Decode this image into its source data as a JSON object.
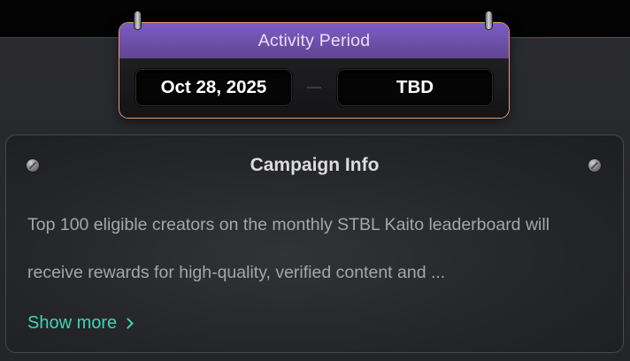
{
  "period": {
    "title": "Activity Period",
    "start_date": "Oct 28, 2025",
    "end_date": "TBD",
    "border_color": "#e89a7b",
    "header_color": "#6f52ad"
  },
  "campaign": {
    "title": "Campaign Info",
    "description": "Top 100 eligible creators on the monthly STBL Kaito leaderboard will receive rewards for high-quality, verified content and ...",
    "show_more_label": "Show more",
    "accent_color": "#3fd5b5"
  },
  "icons": {
    "hangers": "hook-icon",
    "screws": "screw-icon",
    "show_more": "chevron-right-icon"
  }
}
